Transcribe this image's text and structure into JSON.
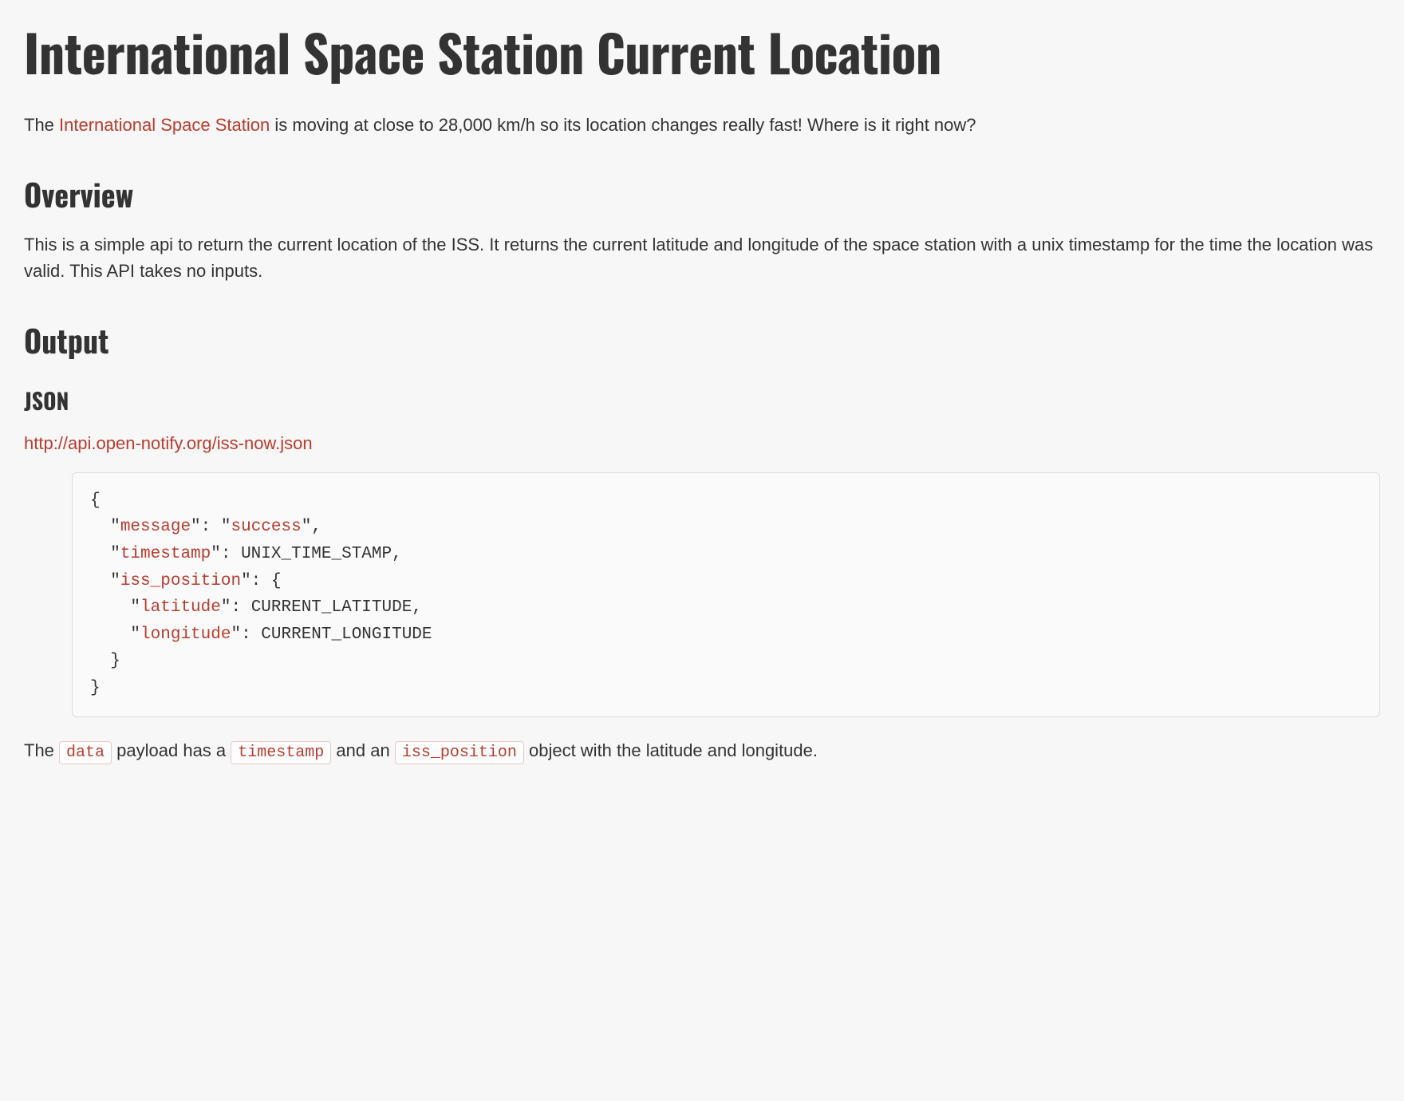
{
  "title": "International Space Station Current Location",
  "intro": {
    "prefix": "The ",
    "link_text": "International Space Station",
    "suffix": " is moving at close to 28,000 km/h so its location changes really fast! Where is it right now?"
  },
  "sections": {
    "overview": {
      "heading": "Overview",
      "body": "This is a simple api to return the current location of the ISS. It returns the current latitude and longitude of the space station with a unix timestamp for the time the location was valid. This API takes no inputs."
    },
    "output": {
      "heading": "Output",
      "json_heading": "JSON",
      "endpoint_url": "http://api.open-notify.org/iss-now.json",
      "code": {
        "l1": "{",
        "l2_key": "message",
        "l2_val": "success",
        "l3_key": "timestamp",
        "l3_val": "UNIX_TIME_STAMP",
        "l4_key": "iss_position",
        "l5_key": "latitude",
        "l5_val": "CURRENT_LATITUDE",
        "l6_key": "longitude",
        "l6_val": "CURRENT_LONGITUDE",
        "l7": "}",
        "l8": "}"
      },
      "footer": {
        "t1": "The ",
        "c1": "data",
        "t2": " payload has a ",
        "c2": "timestamp",
        "t3": " and an ",
        "c3": "iss_position",
        "t4": " object with the latitude and longitude."
      }
    }
  }
}
